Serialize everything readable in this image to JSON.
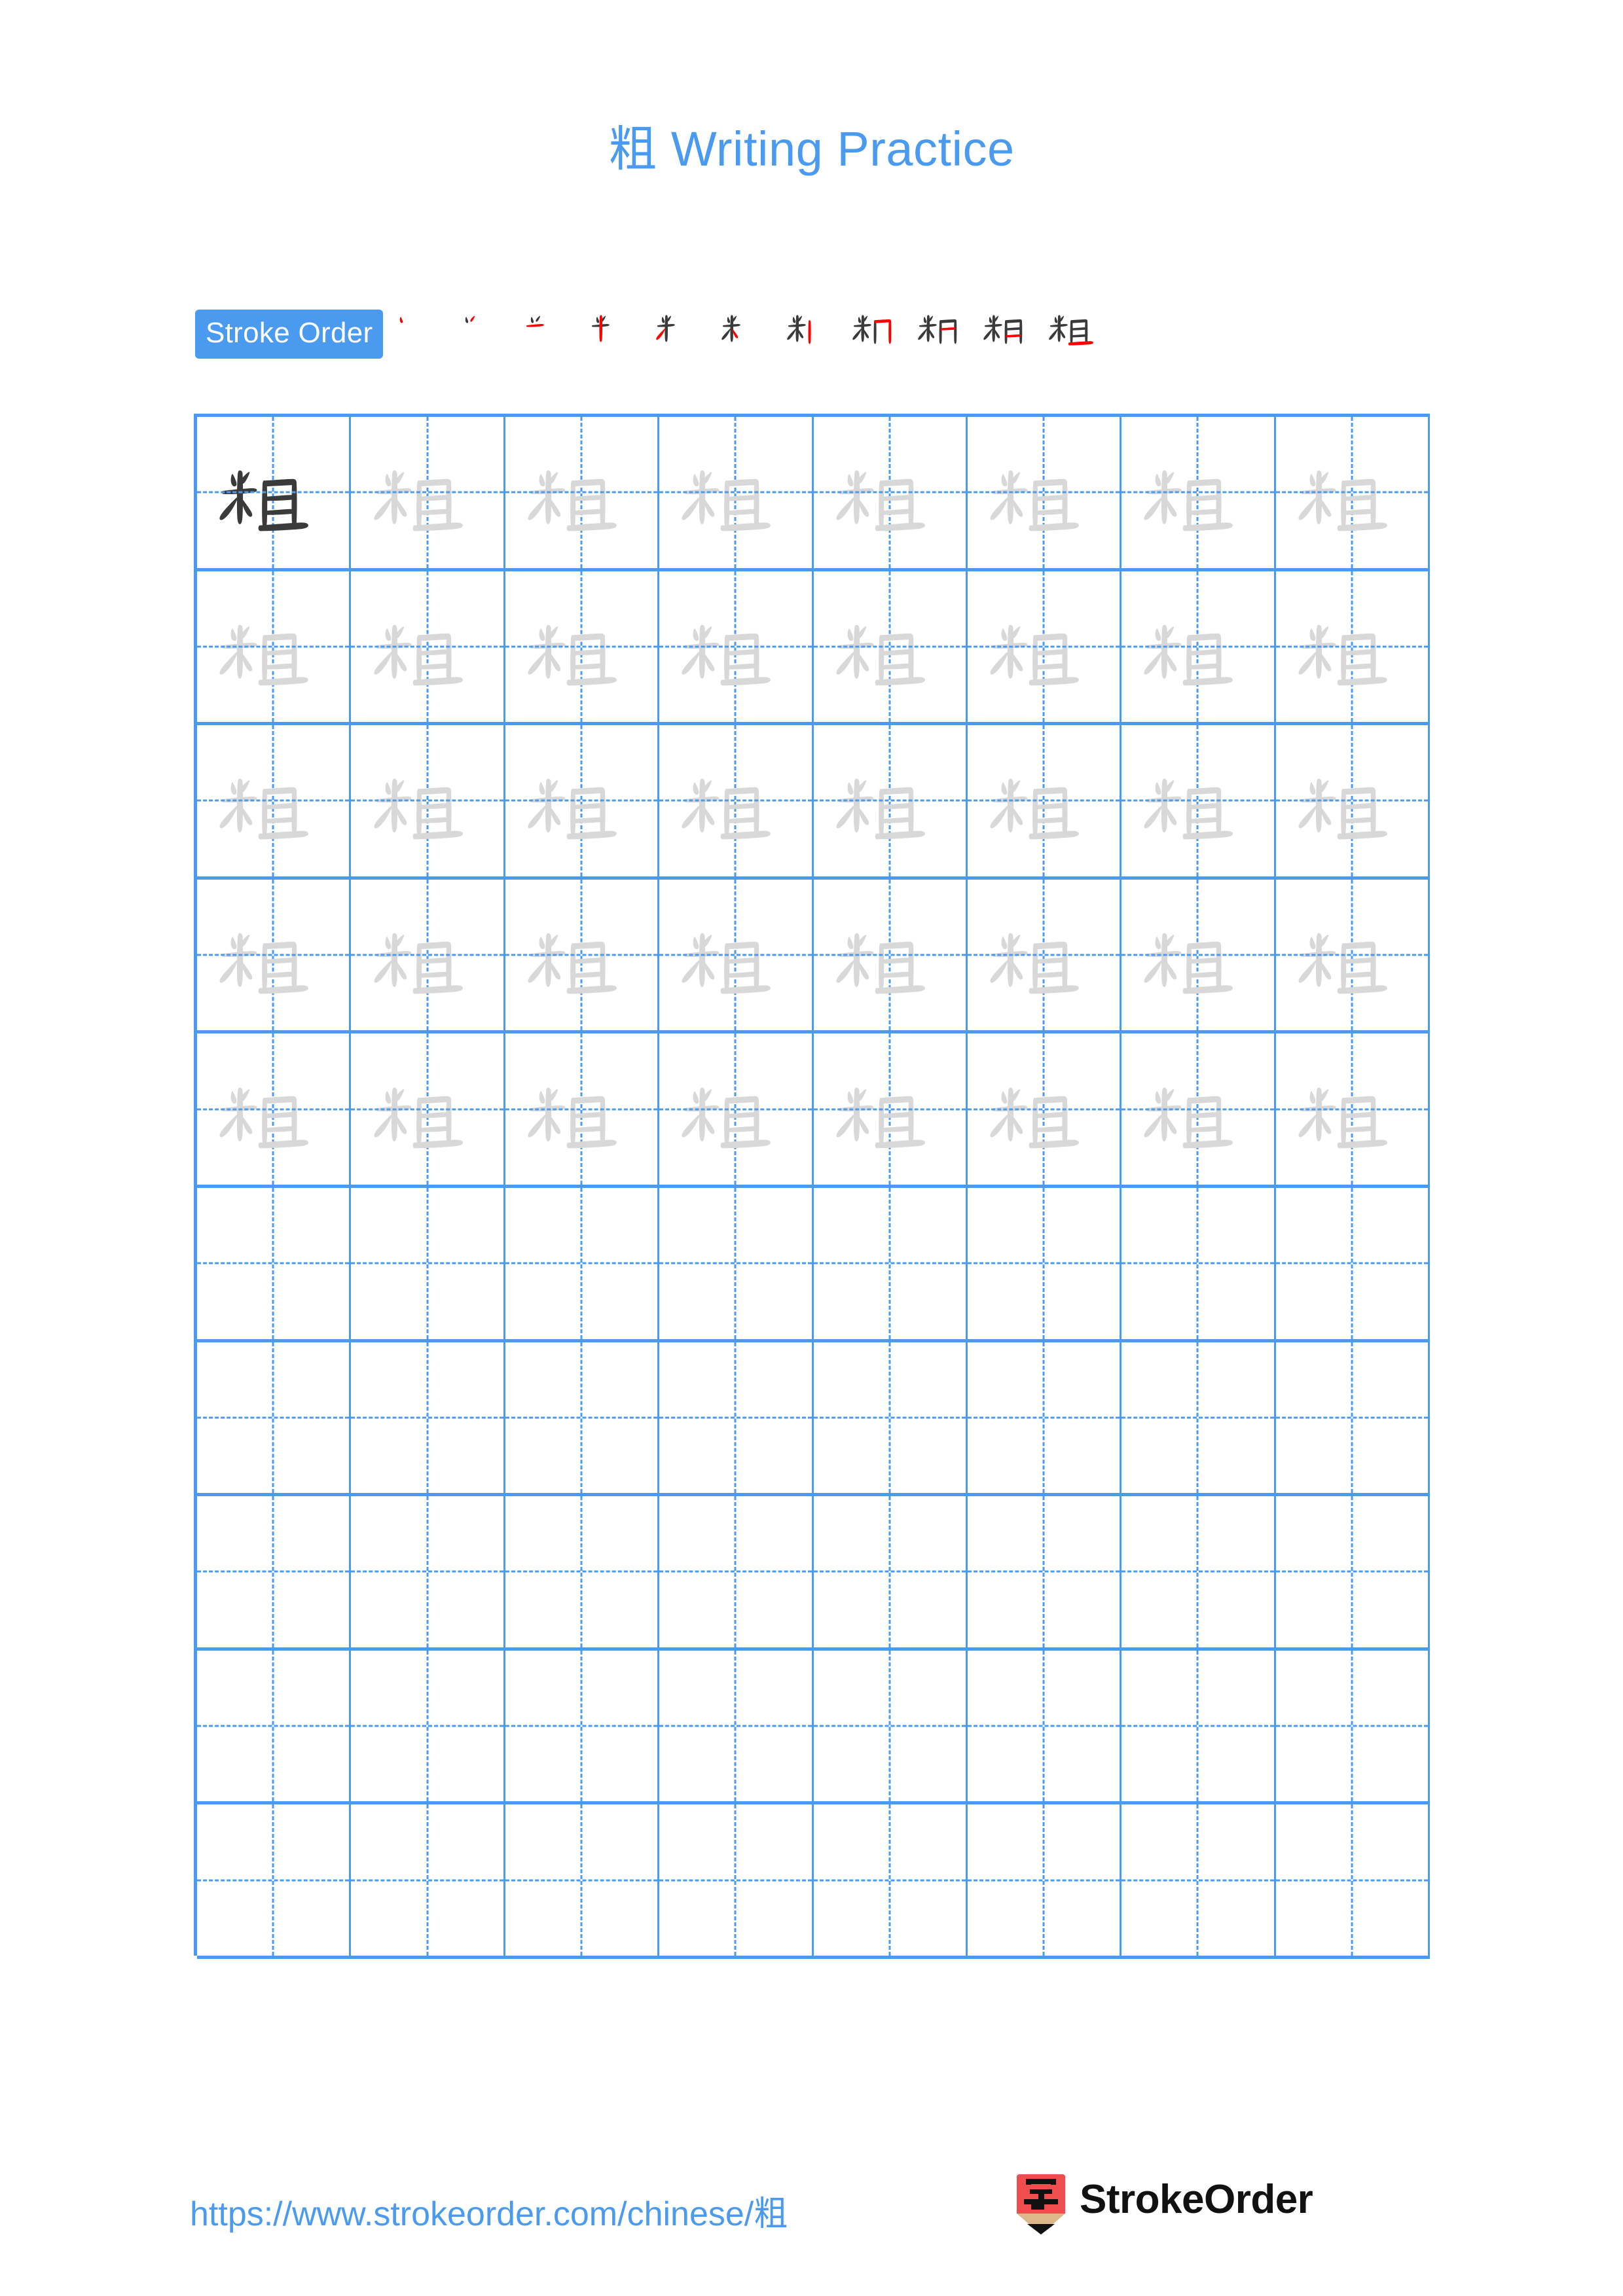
{
  "page": {
    "character": "粗",
    "title": "粗 Writing Practice",
    "background": "#ffffff",
    "accent_color": "#4a9bef",
    "model_char_color": "#3a3a3a",
    "trace_char_color": "#d8d8d8",
    "new_stroke_color": "#ff0000"
  },
  "stroke_order": {
    "badge_label": "Stroke Order",
    "total_strokes": 11,
    "steps": [
      {
        "index": 1,
        "strokes_shown": 1,
        "new_stroke": 1
      },
      {
        "index": 2,
        "strokes_shown": 2,
        "new_stroke": 2
      },
      {
        "index": 3,
        "strokes_shown": 3,
        "new_stroke": 3
      },
      {
        "index": 4,
        "strokes_shown": 4,
        "new_stroke": 4
      },
      {
        "index": 5,
        "strokes_shown": 5,
        "new_stroke": 5
      },
      {
        "index": 6,
        "strokes_shown": 6,
        "new_stroke": 6
      },
      {
        "index": 7,
        "strokes_shown": 7,
        "new_stroke": 7
      },
      {
        "index": 8,
        "strokes_shown": 8,
        "new_stroke": 8
      },
      {
        "index": 9,
        "strokes_shown": 9,
        "new_stroke": 9
      },
      {
        "index": 10,
        "strokes_shown": 10,
        "new_stroke": 10
      },
      {
        "index": 11,
        "strokes_shown": 11,
        "new_stroke": 11
      }
    ]
  },
  "practice_grid": {
    "rows": 10,
    "columns": 8,
    "filled_rows": 5,
    "first_cell_style": "model",
    "cells": [
      [
        "model",
        "trace",
        "trace",
        "trace",
        "trace",
        "trace",
        "trace",
        "trace"
      ],
      [
        "trace",
        "trace",
        "trace",
        "trace",
        "trace",
        "trace",
        "trace",
        "trace"
      ],
      [
        "trace",
        "trace",
        "trace",
        "trace",
        "trace",
        "trace",
        "trace",
        "trace"
      ],
      [
        "trace",
        "trace",
        "trace",
        "trace",
        "trace",
        "trace",
        "trace",
        "trace"
      ],
      [
        "trace",
        "trace",
        "trace",
        "trace",
        "trace",
        "trace",
        "trace",
        "trace"
      ],
      [
        "empty",
        "empty",
        "empty",
        "empty",
        "empty",
        "empty",
        "empty",
        "empty"
      ],
      [
        "empty",
        "empty",
        "empty",
        "empty",
        "empty",
        "empty",
        "empty",
        "empty"
      ],
      [
        "empty",
        "empty",
        "empty",
        "empty",
        "empty",
        "empty",
        "empty",
        "empty"
      ],
      [
        "empty",
        "empty",
        "empty",
        "empty",
        "empty",
        "empty",
        "empty",
        "empty"
      ],
      [
        "empty",
        "empty",
        "empty",
        "empty",
        "empty",
        "empty",
        "empty",
        "empty"
      ]
    ]
  },
  "footer": {
    "url": "https://www.strokeorder.com/chinese/粗",
    "brand_name": "StrokeOrder",
    "logo_character": "字",
    "logo_body_color": "#f04e4e",
    "logo_wood_color": "#dcb889",
    "logo_tip_color": "#111111"
  }
}
